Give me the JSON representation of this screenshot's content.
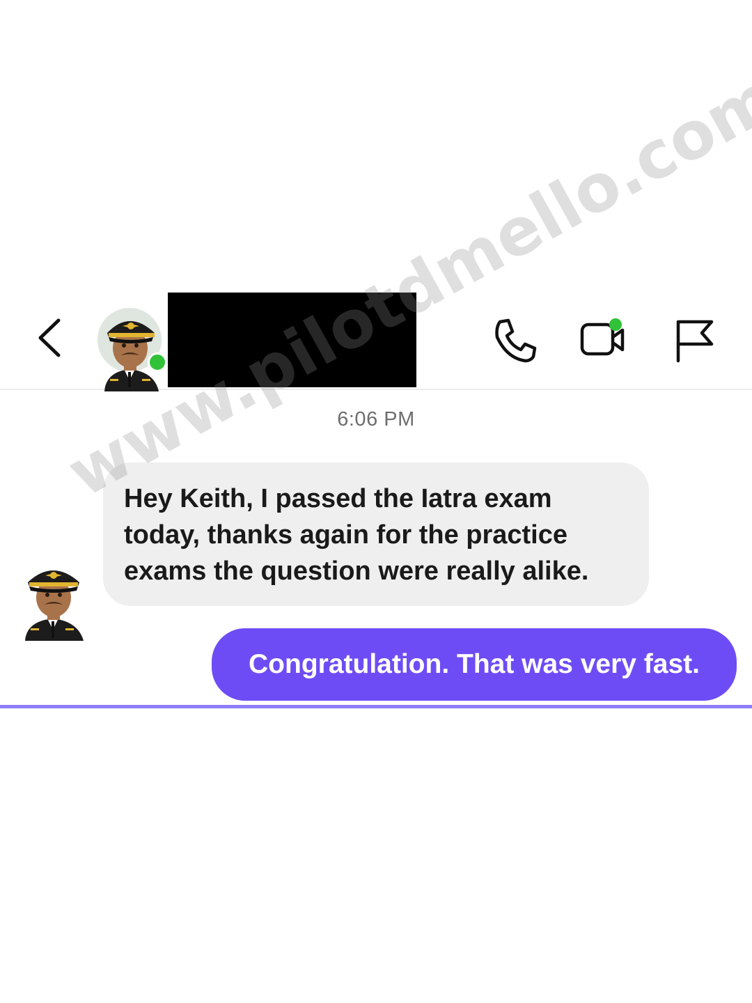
{
  "conversation": {
    "timestamp": "6:06 PM",
    "messages": [
      {
        "direction": "incoming",
        "text": "Hey Keith, I passed the Iatra exam today, thanks again for the practice exams the question were really alike."
      },
      {
        "direction": "outgoing",
        "text": "Congratulation. That was very fast."
      }
    ]
  },
  "header": {
    "contact_avatar_icon": "pilot-avatar",
    "online_status": true,
    "contact_name_redacted": true,
    "actions": [
      "phone-icon",
      "video-call-icon",
      "flag-icon"
    ]
  },
  "watermark": "www.pilotdmello.com",
  "colors": {
    "outgoing_bubble": "#6e4cf5",
    "incoming_bubble": "#efefef",
    "online_dot": "#31c23a"
  }
}
